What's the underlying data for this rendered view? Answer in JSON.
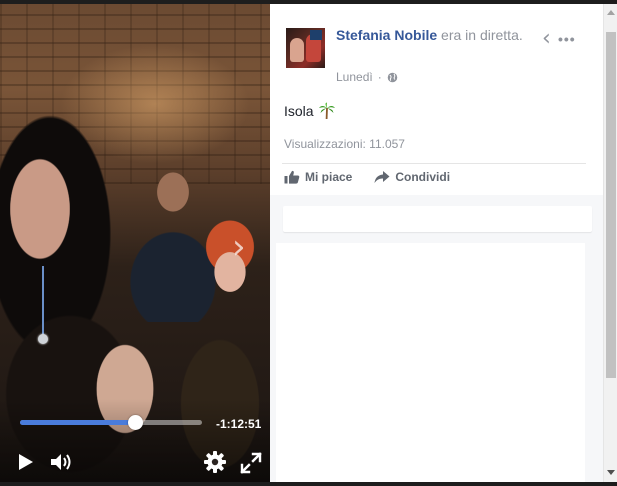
{
  "video": {
    "time_remaining": "-1:12:51",
    "progress_fraction": 0.63,
    "next_icon": "chevron-right-icon",
    "controls": {
      "play_icon": "play-icon",
      "volume_icon": "volume-icon",
      "settings_icon": "gear-icon",
      "fullscreen_icon": "fullscreen-icon"
    }
  },
  "post": {
    "author": "Stefania Nobile",
    "action_text": "era in diretta.",
    "date": "Lunedì",
    "separator": "·",
    "privacy_icon": "globe-icon",
    "text": "Isola",
    "text_emoji_icon": "palm-tree-icon",
    "views": "Visualizzazioni: 11.057",
    "actions": {
      "like": "Mi piace",
      "share": "Condividi"
    }
  },
  "colors": {
    "author_link": "#365899",
    "progress_fill": "#4a7cdb",
    "muted_text": "#90949c"
  }
}
